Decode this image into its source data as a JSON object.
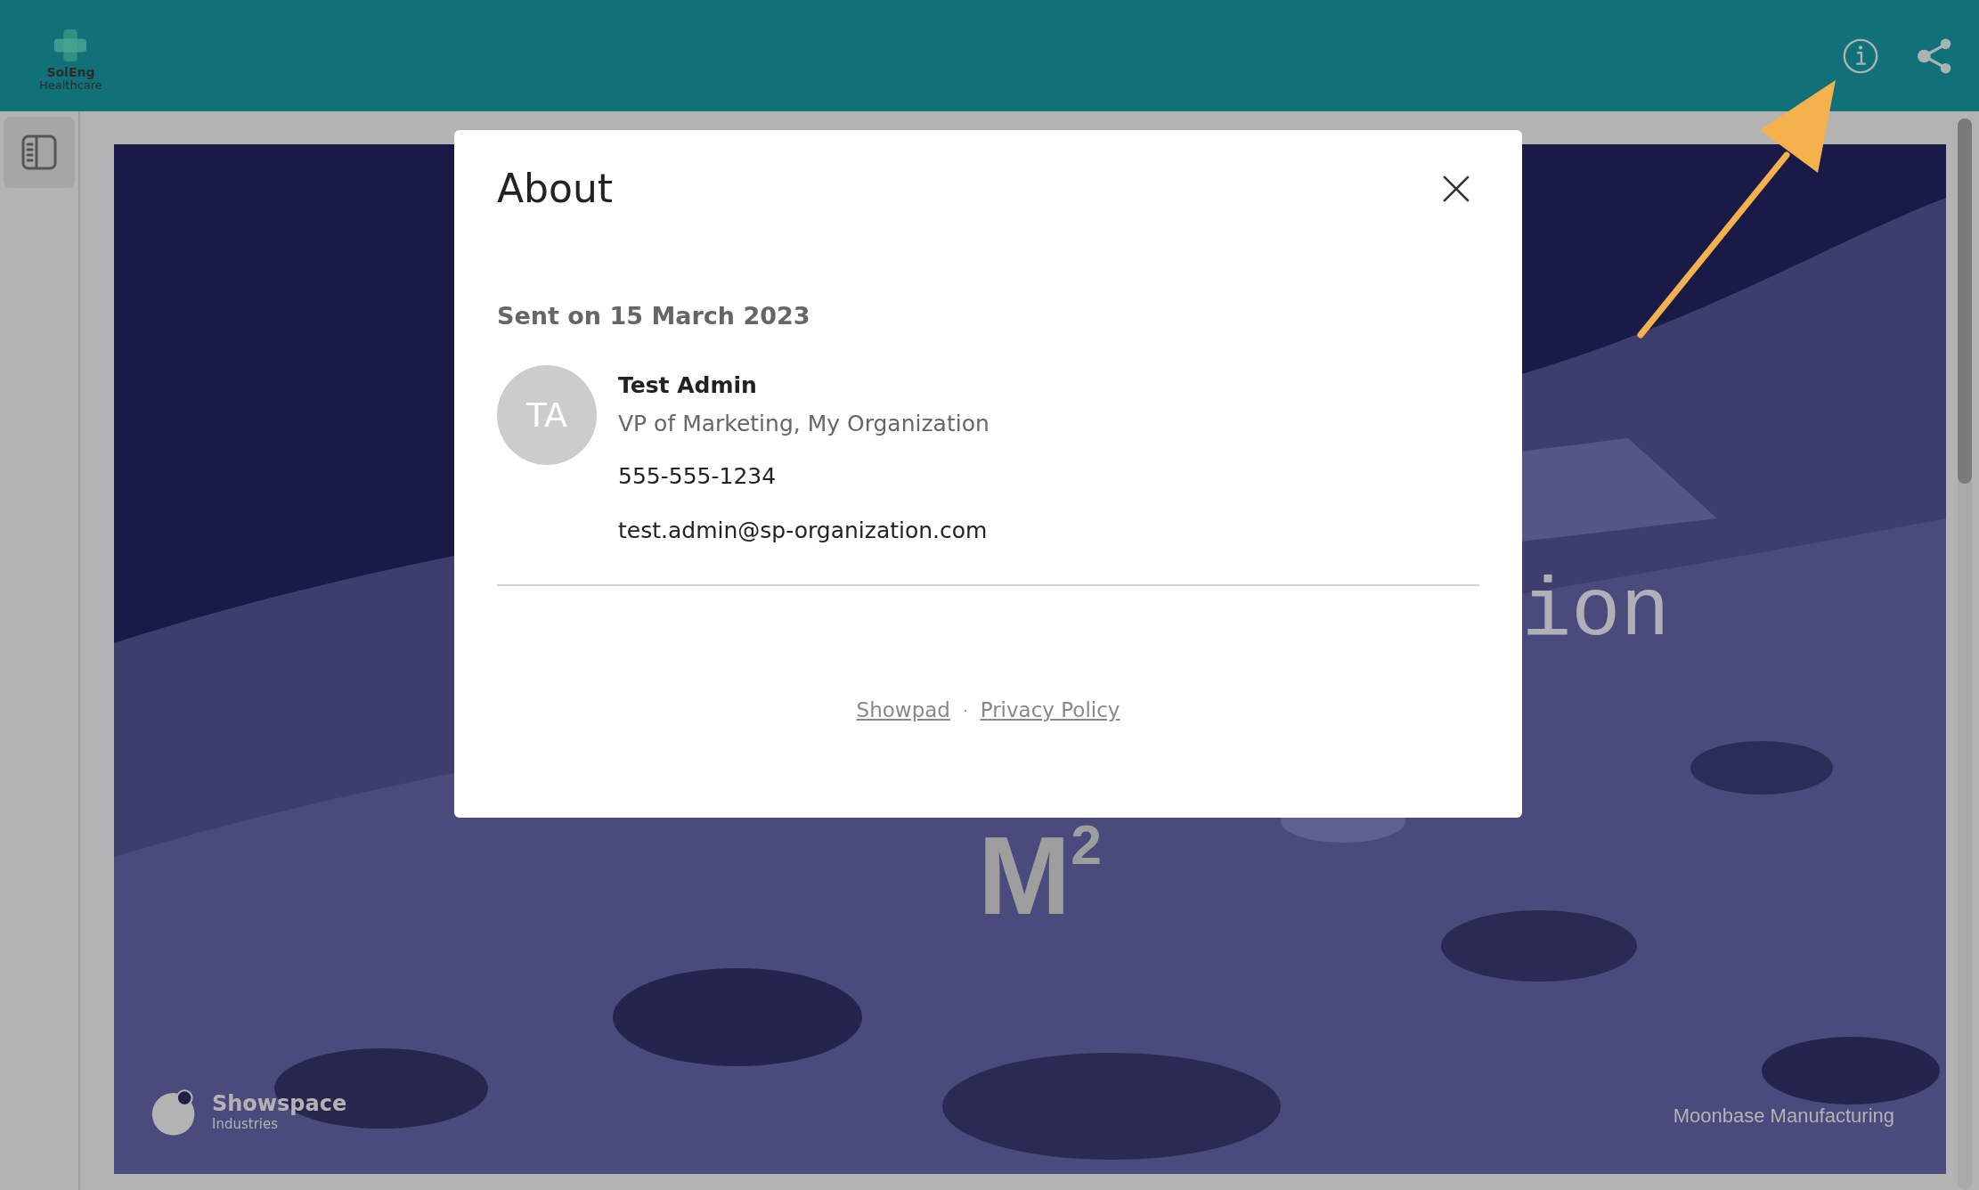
{
  "header": {
    "logo": {
      "name": "SolEng",
      "subtitle": "Healthcare"
    }
  },
  "slide": {
    "title_fragment": "ion",
    "heading": "M$^{2}$",
    "brand": {
      "name": "Showspace",
      "subtitle": "Industries"
    },
    "footer": "Moonbase Manufacturing"
  },
  "dialog": {
    "title": "About",
    "sent": "Sent on 15 March 2023",
    "sender": {
      "initials": "TA",
      "name": "Test Admin",
      "role": "VP of Marketing, My Organization",
      "phone": "555-555-1234",
      "email": "test.admin@sp-organization.com"
    },
    "links": [
      "Showpad",
      "Privacy Policy"
    ],
    "separator": "·"
  }
}
